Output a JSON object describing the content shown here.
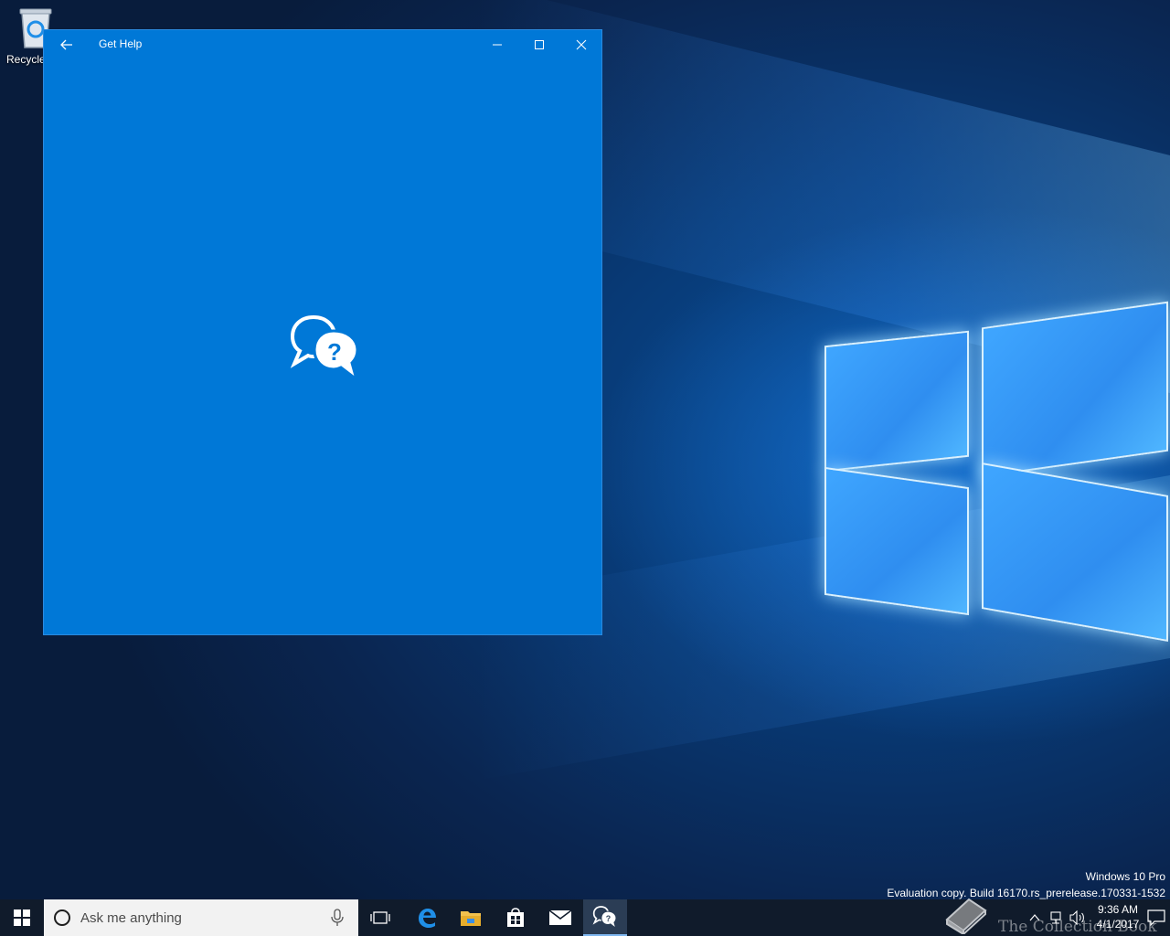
{
  "desktop": {
    "recycle_bin_label": "Recycle"
  },
  "window": {
    "title": "Get Help",
    "back_icon": "arrow-left-icon",
    "minimize_icon": "minimize-icon",
    "maximize_icon": "maximize-icon",
    "close_icon": "close-icon",
    "background_color": "#0078d7",
    "center_icon": "help-chat-bubbles-icon"
  },
  "watermark": {
    "line1": "Windows 10 Pro",
    "line2": "Evaluation copy. Build 16170.rs_prerelease.170331-1532"
  },
  "taskbar": {
    "search_placeholder": "Ask me anything",
    "apps": [
      "task-view-icon",
      "edge-icon",
      "file-explorer-icon",
      "store-icon",
      "mail-icon",
      "get-help-icon"
    ],
    "active_app": "get-help-icon",
    "clock_time": "9:36 AM",
    "clock_date": "4/1/2017",
    "overlay_brand": "The Collection Book"
  }
}
